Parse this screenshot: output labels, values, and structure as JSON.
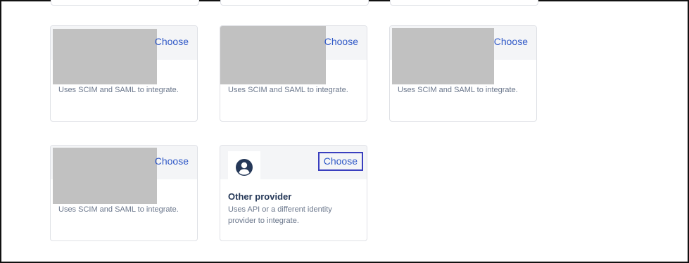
{
  "cards": [
    {
      "choose_label": "Choose",
      "description": "Uses SCIM and SAML to integrate."
    },
    {
      "choose_label": "Choose",
      "description": "Uses SCIM and SAML to integrate."
    },
    {
      "choose_label": "Choose",
      "description": "Uses SCIM and SAML to integrate."
    },
    {
      "choose_label": "Choose",
      "description": "Uses SCIM and SAML to integrate."
    }
  ],
  "other_provider": {
    "title": "Other provider",
    "description_line1": "Uses API or a different identity",
    "description_line2": "provider to integrate.",
    "choose_label": "Choose",
    "icon": "user-circle-icon"
  },
  "colors": {
    "link": "#2f58c7",
    "focus_ring": "#3a3fbf",
    "placeholder": "#c1c1c1"
  }
}
